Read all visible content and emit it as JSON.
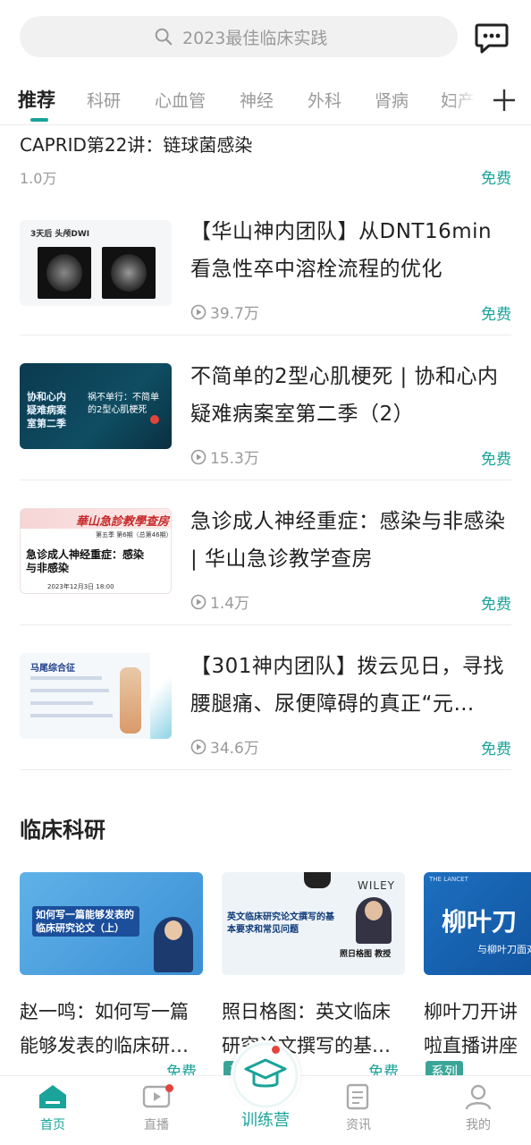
{
  "search": {
    "placeholder": "2023最佳临床实践"
  },
  "tabs": [
    "推荐",
    "科研",
    "心血管",
    "神经",
    "外科",
    "肾病",
    "妇产"
  ],
  "partial_item": {
    "title": "CAPRID第22讲：链球菌感染",
    "views": "1.0万",
    "price": "免费"
  },
  "items": [
    {
      "title": "【华山神内团队】从DNT16min看急性卒中溶栓流程的优化",
      "views": "39.7万",
      "price": "免费",
      "thumb": {
        "caption": "3天后 头颅DWI"
      }
    },
    {
      "title": "不简单的2型心肌梗死 | 协和心内疑难病案室第二季（2）",
      "views": "15.3万",
      "price": "免费",
      "thumb": {
        "left": "协和心内疑难病案室第二季",
        "right": "祸不单行：不简单的2型心肌梗死"
      }
    },
    {
      "title": "急诊成人神经重症：感染与非感染 | 华山急诊教学查房",
      "views": "1.4万",
      "price": "免费",
      "thumb": {
        "brand": "華山急診教學查房",
        "sub": "第五季 第6期（总第46期）",
        "heading": "急诊成人神经重症：感染与非感染",
        "date": "2023年12月3日 18:00"
      }
    },
    {
      "title": "【301神内团队】拨云见日，寻找腰腿痛、尿便障碍的真正“元…",
      "views": "34.6万",
      "price": "免费",
      "thumb": {
        "caption": "马尾综合征"
      }
    }
  ],
  "section": {
    "title": "临床科研",
    "cards": [
      {
        "title": "赵一鸣：如何写一篇能够发表的临床研…",
        "price": "免费",
        "badge": "",
        "thumb": {
          "headline": "如何写一篇能够发表的临床研究论文（上）"
        }
      },
      {
        "title": "照日格图：英文临床研究论文撰写的基…",
        "price": "免费",
        "badge": "系列",
        "thumb": {
          "headline": "英文临床研究论文撰写的基本要求和常见问题",
          "brand": "WILEY",
          "speaker": "照日格图 教授"
        }
      },
      {
        "title": "柳叶刀开讲啦直播讲座",
        "price": "",
        "badge": "系列",
        "thumb": {
          "headline": "柳叶刀",
          "sub": "与柳叶刀面对",
          "brand": "THE LANCET"
        }
      }
    ]
  },
  "nav": [
    {
      "label": "首页",
      "icon": "home-icon",
      "active": true
    },
    {
      "label": "直播",
      "icon": "live-icon",
      "active": false
    },
    {
      "label": "训练营",
      "icon": "graduation-cap-icon",
      "active": false
    },
    {
      "label": "资讯",
      "icon": "news-icon",
      "active": false
    },
    {
      "label": "我的",
      "icon": "profile-icon",
      "active": false
    }
  ],
  "colors": {
    "accent": "#1aa39a",
    "badge_dot": "#e2453c"
  }
}
